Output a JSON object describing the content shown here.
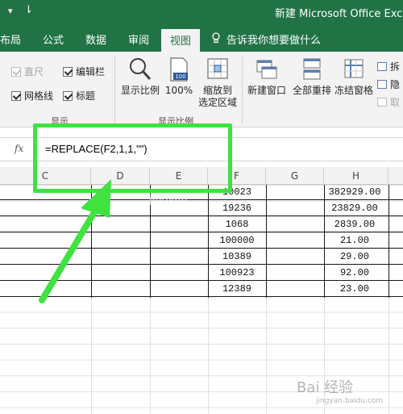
{
  "titlebar": {
    "caret": "▾",
    "qa": "⇂",
    "title": "新建 Microsoft Office Excel"
  },
  "tabs": [
    {
      "label": "布局"
    },
    {
      "label": "公式"
    },
    {
      "label": "数据"
    },
    {
      "label": "审阅"
    },
    {
      "label": "视图",
      "active": true
    }
  ],
  "tell_me": "告诉我你想要做什么",
  "ribbon": {
    "show": {
      "ruler": "直尺",
      "formula_bar": "编辑栏",
      "gridlines": "网格线",
      "headings": "标题",
      "group_label": "显示"
    },
    "zoom": {
      "zoom_label": "显示比例",
      "zoom100_label": "100%",
      "zoom_sel_line1": "缩放到",
      "zoom_sel_line2": "选定区域",
      "zoom100_badge": "100",
      "group_label": "显示比例"
    },
    "window": {
      "new_window": "新建窗口",
      "arrange_all": "全部重排",
      "freeze": "冻结窗格",
      "split": "拆",
      "hide": "隐",
      "unhide": "取"
    }
  },
  "formula_bar": {
    "fx": "fx",
    "formula": "=REPLACE(F2,1,1,\"\")"
  },
  "columns": [
    "C",
    "D",
    "E",
    "F",
    "G",
    "H"
  ],
  "rows": [
    {
      "f": "10023",
      "h": "382929.00"
    },
    {
      "f": "19236",
      "h": "23829.00"
    },
    {
      "f": "1068",
      "h": "2839.00"
    },
    {
      "f": "100000",
      "h": "21.00"
    },
    {
      "f": "10389",
      "h": "29.00"
    },
    {
      "f": "100923",
      "h": "92.00"
    },
    {
      "f": "12389",
      "h": "23.00"
    }
  ],
  "watermark": {
    "main": "Bai 经验",
    "sub": "jingyan.baidu.com",
    "faint": "jingyan"
  },
  "colors": {
    "excel_green": "#217346",
    "highlight_green": "#3fe23f"
  }
}
